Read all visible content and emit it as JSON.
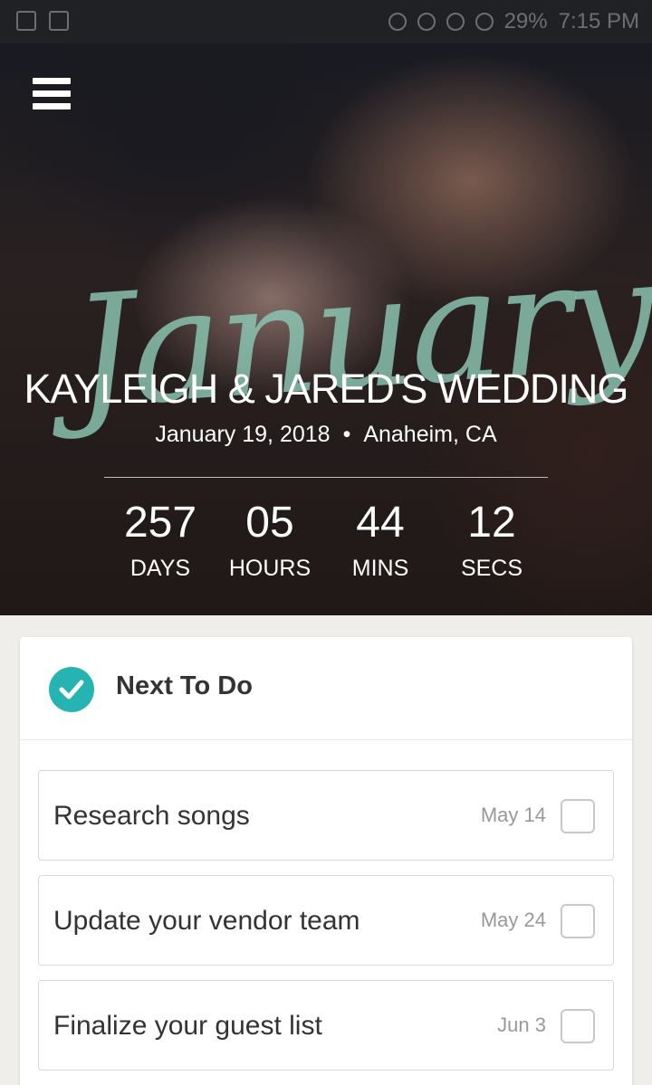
{
  "status_bar": {
    "battery": "29%",
    "time": "7:15 PM"
  },
  "hero": {
    "script_word": "January",
    "title": "KAYLEIGH & JARED'S WEDDING",
    "date": "January 19, 2018",
    "separator": "•",
    "location": "Anaheim, CA"
  },
  "countdown": [
    {
      "value": "257",
      "label": "DAYS"
    },
    {
      "value": "05",
      "label": "HOURS"
    },
    {
      "value": "44",
      "label": "MINS"
    },
    {
      "value": "12",
      "label": "SECS"
    }
  ],
  "todo": {
    "title": "Next To Do",
    "tasks": [
      {
        "label": "Research songs",
        "date": "May 14",
        "checked": false
      },
      {
        "label": "Update your vendor team",
        "date": "May 24",
        "checked": false
      },
      {
        "label": "Finalize your guest list",
        "date": "Jun 3",
        "checked": false
      }
    ]
  },
  "colors": {
    "accent": "#25b4b1",
    "script": "#8cc8b4",
    "background": "#efeeea"
  }
}
